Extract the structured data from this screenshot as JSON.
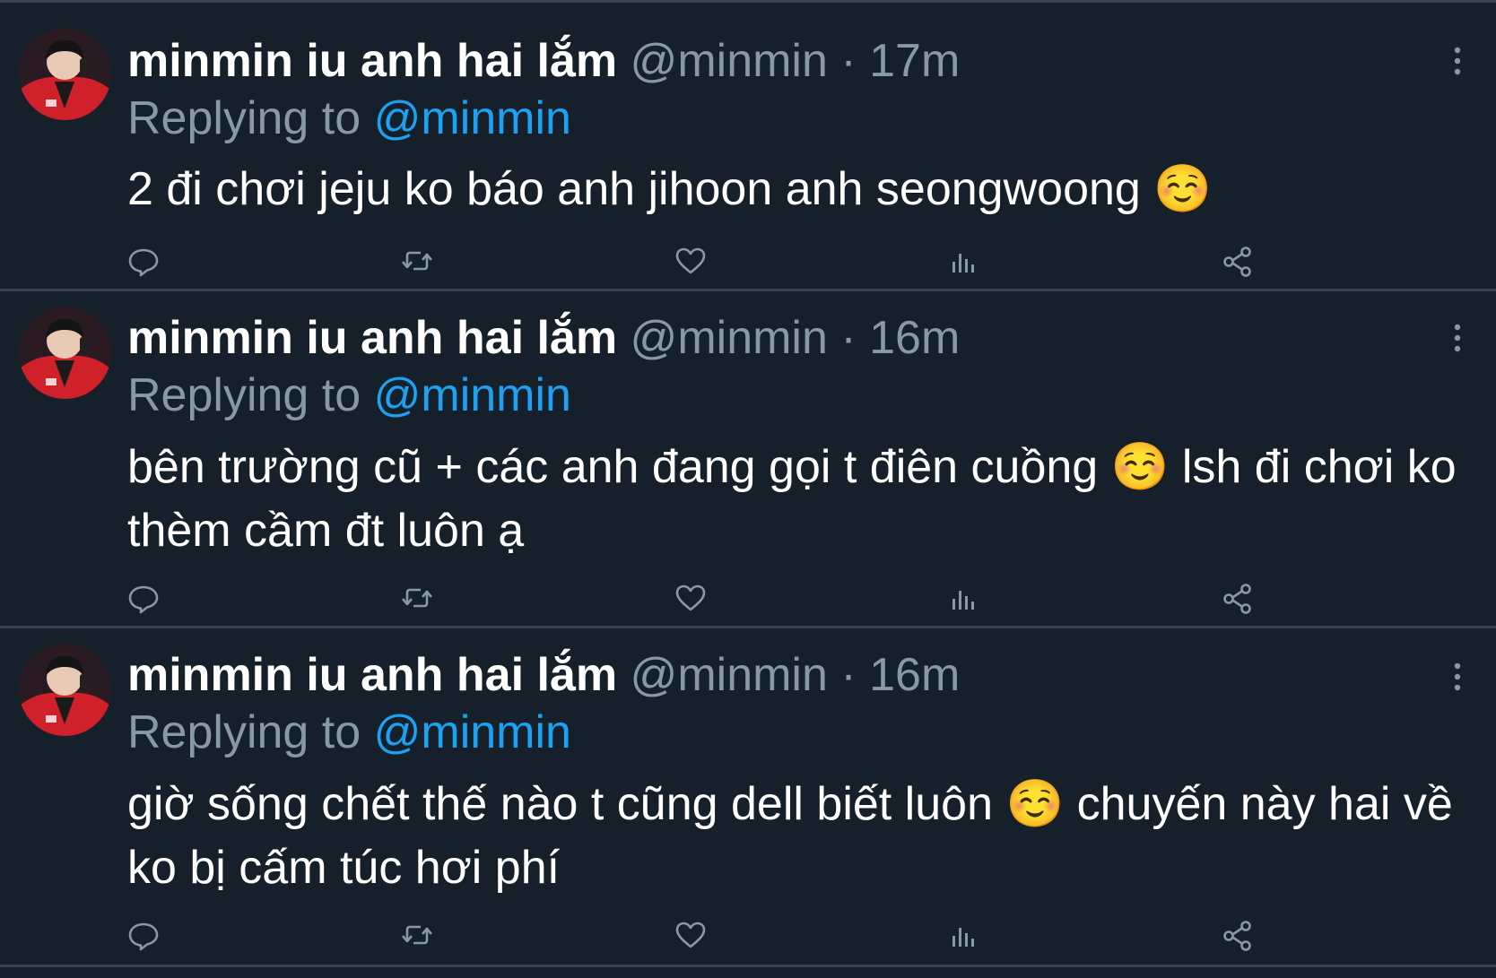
{
  "tweets": [
    {
      "display_name": "minmin iu anh hai lắm",
      "handle": "@minmin",
      "separator": "·",
      "time": "17m",
      "replying_prefix": "Replying to",
      "replying_to": "@minmin",
      "text": "2 đi chơi jeju ko báo anh jihoon anh seongwoong ☺️"
    },
    {
      "display_name": "minmin iu anh hai lắm",
      "handle": "@minmin",
      "separator": "·",
      "time": "16m",
      "replying_prefix": "Replying to",
      "replying_to": "@minmin",
      "text": "bên trường cũ + các anh đang gọi t điên cuồng ☺️ lsh đi chơi ko thèm cầm đt luôn ạ"
    },
    {
      "display_name": "minmin iu anh hai lắm",
      "handle": "@minmin",
      "separator": "·",
      "time": "16m",
      "replying_prefix": "Replying to",
      "replying_to": "@minmin",
      "text": "giờ sống chết thế nào t cũng dell biết luôn ☺️ chuyến này hai về ko bị cấm túc hơi phí"
    }
  ],
  "icons": {
    "reply": "comment-bubble-icon",
    "retweet": "retweet-arrows-icon",
    "like": "heart-icon",
    "analytics": "bar-chart-icon",
    "share": "share-nodes-icon",
    "more": "vertical-ellipsis-icon"
  },
  "colors": {
    "background": "#15202b",
    "divider": "#38444d",
    "secondary_text": "#8899a6",
    "mention": "#1da1f2",
    "avatar_jacket": "#d0202a"
  }
}
